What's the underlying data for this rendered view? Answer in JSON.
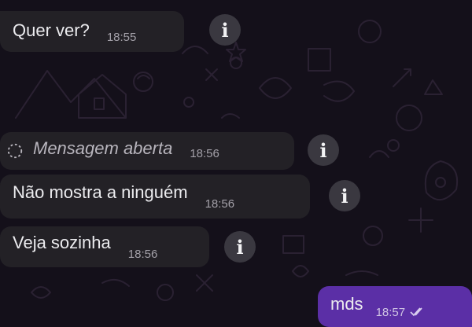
{
  "messages": [
    {
      "text": "Quer ver?",
      "time": "18:55",
      "direction": "received"
    },
    {
      "text": "Mensagem aberta",
      "time": "18:56",
      "direction": "received",
      "status_icon": "view-once-opened-icon"
    },
    {
      "text": "Não mostra a ninguém",
      "time": "18:56",
      "direction": "received"
    },
    {
      "text": "Veja sozinha",
      "time": "18:56",
      "direction": "received"
    },
    {
      "text": "mds",
      "time": "18:57",
      "direction": "sent",
      "status_icon": "double-check-icon"
    }
  ],
  "info_button": {
    "label": "i",
    "icon": "info-icon"
  },
  "colors": {
    "background": "#14101a",
    "received_bubble": "#232126",
    "sent_bubble": "#5b2fa6",
    "info_button": "#3a3840"
  }
}
